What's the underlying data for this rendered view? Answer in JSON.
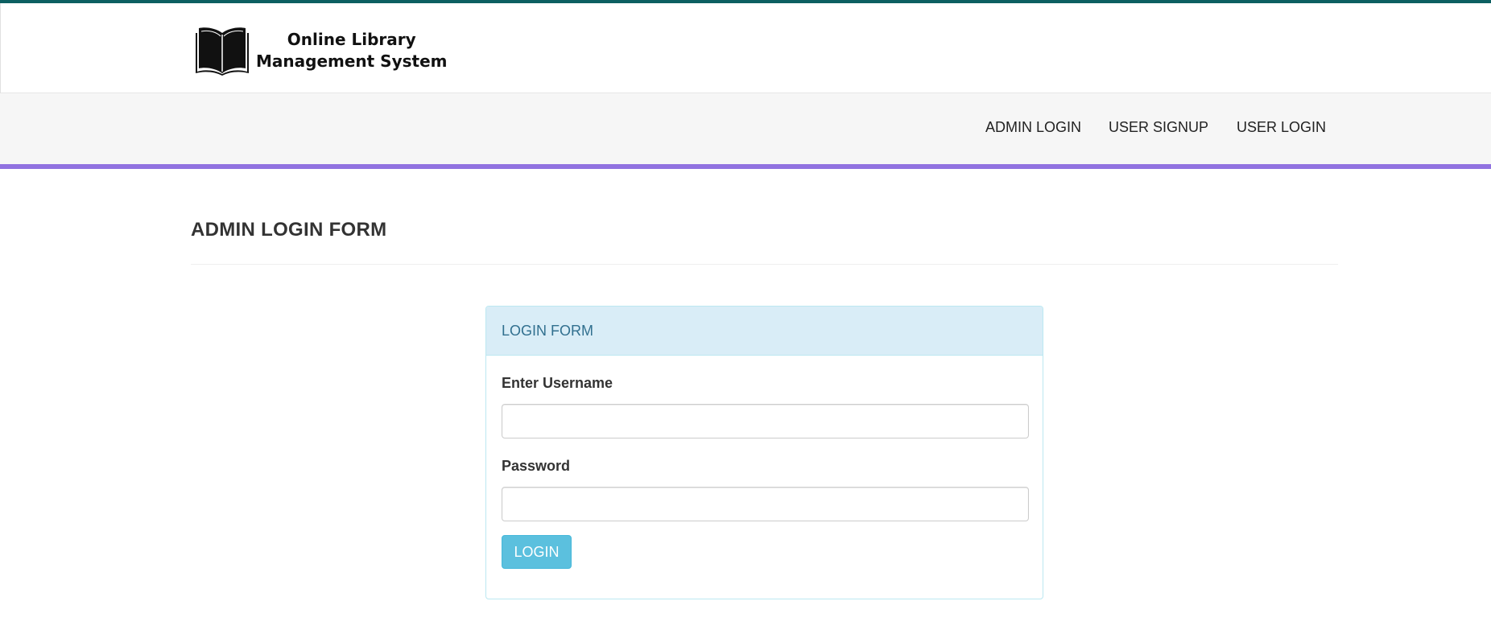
{
  "brand": {
    "line1": "Online Library",
    "line2": "Management System",
    "icon": "book-icon"
  },
  "nav": {
    "items": [
      {
        "label": "ADMIN LOGIN"
      },
      {
        "label": "USER SIGNUP"
      },
      {
        "label": "USER LOGIN"
      }
    ]
  },
  "page": {
    "title": "ADMIN LOGIN FORM"
  },
  "form": {
    "heading": "LOGIN FORM",
    "username_label": "Enter Username",
    "username_value": "",
    "password_label": "Password",
    "password_value": "",
    "submit_label": "LOGIN"
  },
  "colors": {
    "top_strip": "#0c5f61",
    "accent_bar": "#9172e0",
    "panel_heading_bg": "#d9edf7",
    "panel_heading_text": "#31708f",
    "button_bg": "#5bc0de"
  }
}
